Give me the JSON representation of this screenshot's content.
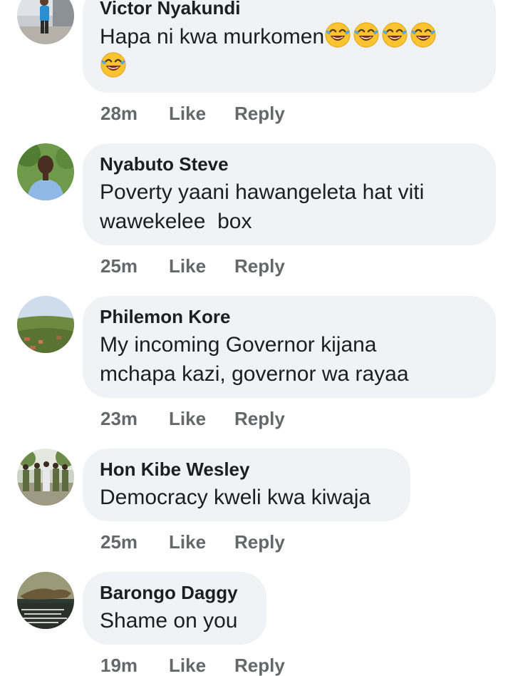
{
  "comments": [
    {
      "author": "Victor Nyakundi",
      "text": "Hapa ni kwa murkomen",
      "emoji_count": 5,
      "emoji_icon": "laughing-tears-emoji",
      "time": "28m",
      "like_label": "Like",
      "reply_label": "Reply"
    },
    {
      "author": "Nyabuto Steve",
      "text_line1": "Poverty yaani hawangeleta hat viti",
      "text_line2": "wawekelee  box",
      "time": "25m",
      "like_label": "Like",
      "reply_label": "Reply"
    },
    {
      "author": "Philemon Kore",
      "text_line1": "My incoming Governor kijana",
      "text_line2": "mchapa kazi, governor wa rayaa",
      "time": "23m",
      "like_label": "Like",
      "reply_label": "Reply"
    },
    {
      "author": "Hon Kibe Wesley",
      "text": "Democracy kweli kwa kiwaja",
      "time": "25m",
      "like_label": "Like",
      "reply_label": "Reply"
    },
    {
      "author": "Barongo Daggy",
      "text": "Shame on you",
      "time": "19m",
      "like_label": "Like",
      "reply_label": "Reply"
    }
  ],
  "colors": {
    "bubble": "#f0f2f5",
    "text": "#1c1e21",
    "meta": "#65676b"
  }
}
